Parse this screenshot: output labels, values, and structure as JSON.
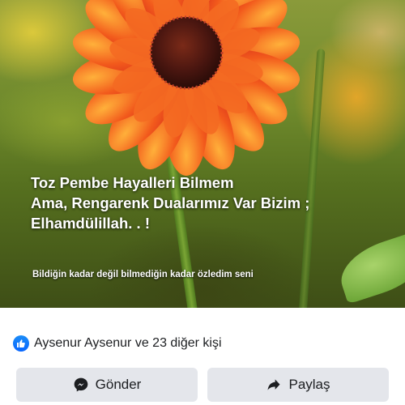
{
  "post": {
    "image_text": {
      "line1": "Toz Pembe Hayalleri Bilmem",
      "line2": "Ama, Rengarenk Dualarımız Var Bizim ;",
      "line3": "Elhamdülillah. . !",
      "subtitle": "Bildiğin kadar değil bilmediğin kadar özledim seni"
    },
    "reactions": {
      "icon": "like-icon",
      "text": "Aysenur Aysenur ve 23 diğer kişi"
    }
  },
  "actions": {
    "send_label": "Gönder",
    "share_label": "Paylaş"
  },
  "colors": {
    "button_bg": "#e4e6eb",
    "like_blue": "#0866ff",
    "flower_orange": "#f0501e"
  }
}
